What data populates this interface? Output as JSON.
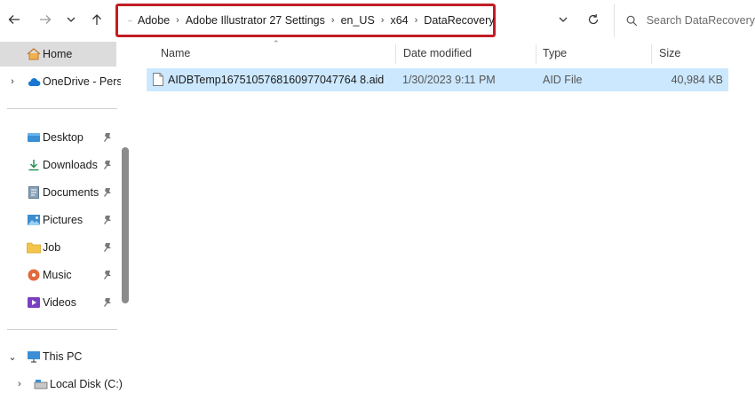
{
  "address_bar": {
    "path": [
      "Adobe",
      "Adobe Illustrator 27 Settings",
      "en_US",
      "x64",
      "DataRecovery"
    ]
  },
  "search": {
    "placeholder": "Search DataRecovery"
  },
  "nav_pane": {
    "home": "Home",
    "onedrive": "OneDrive - Perso",
    "quick_access": [
      "Desktop",
      "Downloads",
      "Documents",
      "Pictures",
      "Job",
      "Music",
      "Videos"
    ],
    "this_pc": "This PC",
    "local_disk": "Local Disk (C:)"
  },
  "columns": {
    "name": "Name",
    "date": "Date modified",
    "type": "Type",
    "size": "Size"
  },
  "files": [
    {
      "name": "AIDBTemp1675105768160977047764 8.aid",
      "date": "1/30/2023 9:11 PM",
      "type": "AID File",
      "size": "40,984 KB"
    }
  ],
  "colors": {
    "highlight_box": "#c21d25",
    "selected_row": "#cce8ff",
    "folder": "#f3c54b"
  },
  "icons": [
    "back-arrow-icon",
    "forward-arrow-icon",
    "chevron-down-icon",
    "up-arrow-icon",
    "folder-icon",
    "refresh-icon",
    "search-icon",
    "home-icon",
    "cloud-icon",
    "pin-icon",
    "file-icon",
    "pc-icon",
    "drive-icon"
  ]
}
